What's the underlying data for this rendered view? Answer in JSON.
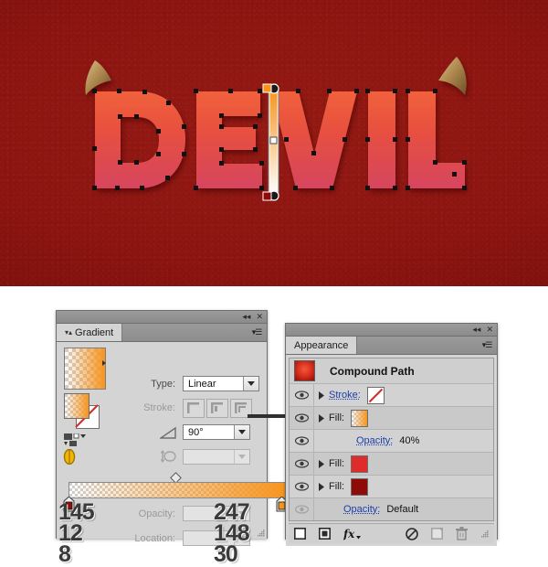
{
  "artwork": {
    "name": "devil-text-artwork",
    "word": "DEVIL",
    "background_color": "#8c1410",
    "letter_gradient_top": "#ef5a3a",
    "letter_gradient_bottom": "#d6445c",
    "horn_color": "#b08a50",
    "gradient_annotator": {
      "start_color": "#f7941e",
      "end_color": "#ffffff",
      "angle_label": "90°"
    }
  },
  "gradient_panel": {
    "title": "Gradient",
    "collapse_icon": "double-left-chevron-icon",
    "close_icon": "close-icon",
    "menu_icon": "panel-menu-icon",
    "swatch_name": "gradient-swatch",
    "type": {
      "label": "Type:",
      "value": "Linear"
    },
    "stroke": {
      "label": "Stroke:",
      "options": [
        "stroke-within",
        "stroke-centered",
        "stroke-outside"
      ]
    },
    "angle": {
      "label": "angle-icon",
      "value": "90°"
    },
    "aspect": {
      "label": "aspect-ratio-icon",
      "value": ""
    },
    "opacity": {
      "label": "Opacity:",
      "value": ""
    },
    "location": {
      "label": "Location:",
      "value": ""
    },
    "reverse_icon": "reverse-gradient-icon",
    "delete_icon": "trash-icon",
    "stops": [
      {
        "name": "gradient-stop-left",
        "color": "#911008",
        "r": "145",
        "g": "12",
        "b": "8",
        "location": "0%"
      },
      {
        "name": "gradient-stop-right",
        "color": "#f7941e",
        "r": "247",
        "g": "148",
        "b": "30",
        "location": "100%"
      }
    ],
    "midpoint_name": "gradient-midpoint-diamond"
  },
  "appearance_panel": {
    "title": "Appearance",
    "collapse_icon": "double-left-chevron-icon",
    "close_icon": "close-icon",
    "menu_icon": "panel-menu-icon",
    "object_title": "Compound Path",
    "rows": [
      {
        "name": "appearance-row-stroke",
        "label": "Stroke:",
        "value": "",
        "swatch": "none",
        "has_eye": true,
        "eye_on": true,
        "has_disclosure": true,
        "indent": 0
      },
      {
        "name": "appearance-row-fill-1",
        "label": "Fill:",
        "value": "",
        "swatch": "gradient-orange",
        "has_eye": true,
        "eye_on": true,
        "has_disclosure": true,
        "indent": 0
      },
      {
        "name": "appearance-row-opacity-1",
        "label": "Opacity:",
        "value": "40%",
        "swatch": "",
        "has_eye": true,
        "eye_on": true,
        "has_disclosure": false,
        "indent": 1
      },
      {
        "name": "appearance-row-fill-2",
        "label": "Fill:",
        "value": "",
        "swatch": "#e02b2b",
        "has_eye": true,
        "eye_on": true,
        "has_disclosure": true,
        "indent": 0
      },
      {
        "name": "appearance-row-fill-3",
        "label": "Fill:",
        "value": "",
        "swatch": "#8e0b08",
        "has_eye": true,
        "eye_on": true,
        "has_disclosure": true,
        "indent": 0
      },
      {
        "name": "appearance-row-opacity-2",
        "label": "Opacity:",
        "value": "Default",
        "swatch": "",
        "has_eye": true,
        "eye_on": false,
        "has_disclosure": false,
        "indent": 1
      }
    ],
    "footer": {
      "add_stroke_icon": "add-new-stroke-icon",
      "add_fill_icon": "add-new-fill-icon",
      "fx_icon": "add-effect-fx-icon",
      "clear_icon": "clear-appearance-icon",
      "duplicate_icon": "duplicate-item-icon",
      "delete_icon": "delete-item-icon"
    }
  },
  "connector": {
    "name": "callout-connector-line"
  }
}
